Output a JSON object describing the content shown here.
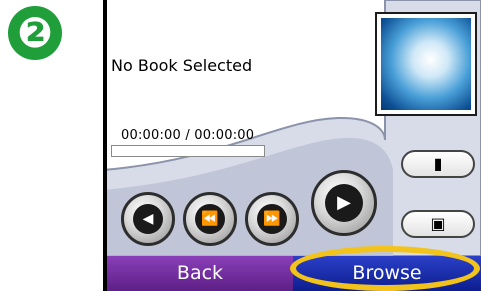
{
  "step_badge": "❷",
  "player": {
    "book_title": "No Book Selected",
    "time_readout": "00:00:00 / 00:00:00",
    "progress": 0
  },
  "controls": {
    "volume": "volume-icon",
    "rewind": "rewind-icon",
    "fast_forward": "fast-forward-icon",
    "play": "play-icon",
    "bookmark": "bookmark-icon",
    "chapters": "chapters-icon"
  },
  "bottom_bar": {
    "back_label": "Back",
    "browse_label": "Browse"
  },
  "colors": {
    "badge": "#1f9e3a",
    "back_button": "#6f2aa0",
    "browse_button": "#1a2ba6",
    "highlight": "#f2c31b",
    "panel": "#d7dce8"
  }
}
